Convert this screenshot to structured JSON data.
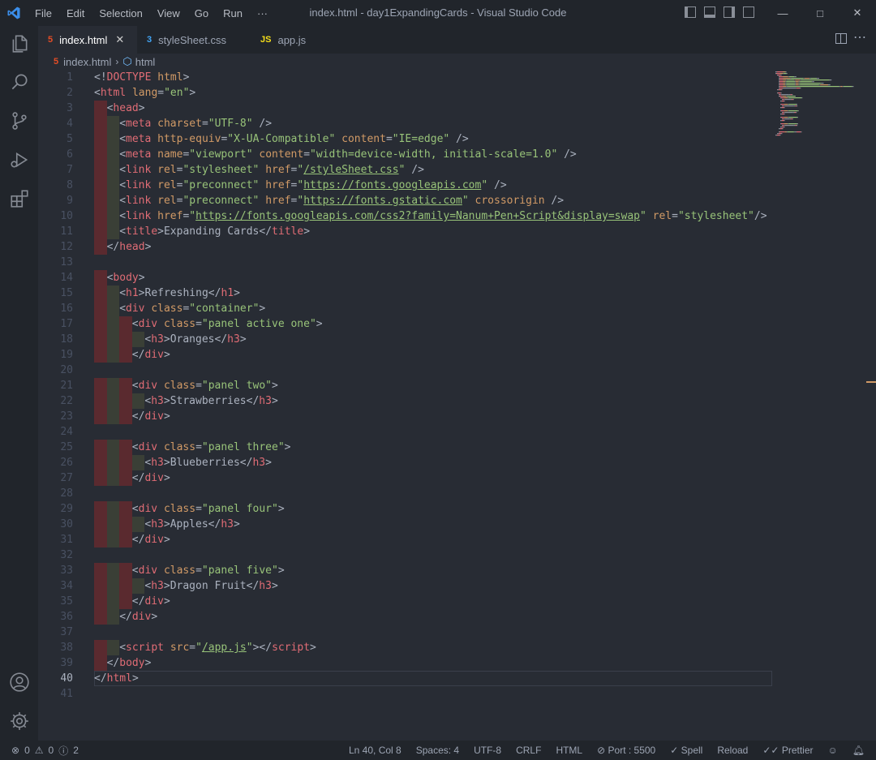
{
  "menu": [
    "File",
    "Edit",
    "Selection",
    "View",
    "Go",
    "Run",
    "···"
  ],
  "window_title": "index.html - day1ExpandingCards - Visual Studio Code",
  "tabs": [
    {
      "label": "index.html",
      "icon": "5",
      "icon_color": "#e44d26"
    },
    {
      "label": "styleSheet.css",
      "icon": "3",
      "icon_color": "#42a5f5"
    },
    {
      "label": "app.js",
      "icon": "JS",
      "icon_color": "#f5de19"
    }
  ],
  "breadcrumb": {
    "file": "index.html",
    "element": "html"
  },
  "editor": {
    "current_line": 40,
    "lines": [
      {
        "n": 1,
        "i": 0,
        "toks": [
          [
            "t-pun",
            "<!"
          ],
          [
            "t-tag",
            "DOCTYPE "
          ],
          [
            "t-attr",
            "html"
          ],
          [
            "t-pun",
            ">"
          ]
        ]
      },
      {
        "n": 2,
        "i": 0,
        "toks": [
          [
            "t-pun",
            "<"
          ],
          [
            "t-tag",
            "html "
          ],
          [
            "t-attr",
            "lang"
          ],
          [
            "t-pun",
            "="
          ],
          [
            "t-str",
            "\"en\""
          ],
          [
            "t-pun",
            ">"
          ]
        ]
      },
      {
        "n": 3,
        "i": 1,
        "toks": [
          [
            "t-pun",
            "<"
          ],
          [
            "t-tag",
            "head"
          ],
          [
            "t-pun",
            ">"
          ]
        ]
      },
      {
        "n": 4,
        "i": 2,
        "toks": [
          [
            "t-pun",
            "<"
          ],
          [
            "t-tag",
            "meta "
          ],
          [
            "t-attr",
            "charset"
          ],
          [
            "t-pun",
            "="
          ],
          [
            "t-str",
            "\"UTF-8\""
          ],
          [
            "t-pun",
            " />"
          ]
        ]
      },
      {
        "n": 5,
        "i": 2,
        "toks": [
          [
            "t-pun",
            "<"
          ],
          [
            "t-tag",
            "meta "
          ],
          [
            "t-attr",
            "http-equiv"
          ],
          [
            "t-pun",
            "="
          ],
          [
            "t-str",
            "\"X-UA-Compatible\""
          ],
          [
            "t-pun",
            " "
          ],
          [
            "t-attr",
            "content"
          ],
          [
            "t-pun",
            "="
          ],
          [
            "t-str",
            "\"IE=edge\""
          ],
          [
            "t-pun",
            " />"
          ]
        ]
      },
      {
        "n": 6,
        "i": 2,
        "toks": [
          [
            "t-pun",
            "<"
          ],
          [
            "t-tag",
            "meta "
          ],
          [
            "t-attr",
            "name"
          ],
          [
            "t-pun",
            "="
          ],
          [
            "t-str",
            "\"viewport\""
          ],
          [
            "t-pun",
            " "
          ],
          [
            "t-attr",
            "content"
          ],
          [
            "t-pun",
            "="
          ],
          [
            "t-str",
            "\"width=device-width, initial-scale=1.0\""
          ],
          [
            "t-pun",
            " />"
          ]
        ]
      },
      {
        "n": 7,
        "i": 2,
        "toks": [
          [
            "t-pun",
            "<"
          ],
          [
            "t-tag",
            "link "
          ],
          [
            "t-attr",
            "rel"
          ],
          [
            "t-pun",
            "="
          ],
          [
            "t-str",
            "\"stylesheet\""
          ],
          [
            "t-pun",
            " "
          ],
          [
            "t-attr",
            "href"
          ],
          [
            "t-pun",
            "="
          ],
          [
            "t-str",
            "\""
          ],
          [
            "t-link",
            "/styleSheet.css"
          ],
          [
            "t-str",
            "\""
          ],
          [
            "t-pun",
            " />"
          ]
        ]
      },
      {
        "n": 8,
        "i": 2,
        "toks": [
          [
            "t-pun",
            "<"
          ],
          [
            "t-tag",
            "link "
          ],
          [
            "t-attr",
            "rel"
          ],
          [
            "t-pun",
            "="
          ],
          [
            "t-str",
            "\"preconnect\""
          ],
          [
            "t-pun",
            " "
          ],
          [
            "t-attr",
            "href"
          ],
          [
            "t-pun",
            "="
          ],
          [
            "t-str",
            "\""
          ],
          [
            "t-link",
            "https://fonts.googleapis.com"
          ],
          [
            "t-str",
            "\""
          ],
          [
            "t-pun",
            " />"
          ]
        ]
      },
      {
        "n": 9,
        "i": 2,
        "toks": [
          [
            "t-pun",
            "<"
          ],
          [
            "t-tag",
            "link "
          ],
          [
            "t-attr",
            "rel"
          ],
          [
            "t-pun",
            "="
          ],
          [
            "t-str",
            "\"preconnect\""
          ],
          [
            "t-pun",
            " "
          ],
          [
            "t-attr",
            "href"
          ],
          [
            "t-pun",
            "="
          ],
          [
            "t-str",
            "\""
          ],
          [
            "t-link",
            "https://fonts.gstatic.com"
          ],
          [
            "t-str",
            "\""
          ],
          [
            "t-pun",
            " "
          ],
          [
            "t-attr",
            "crossorigin"
          ],
          [
            "t-pun",
            " />"
          ]
        ]
      },
      {
        "n": 10,
        "i": 2,
        "toks": [
          [
            "t-pun",
            "<"
          ],
          [
            "t-tag",
            "link "
          ],
          [
            "t-attr",
            "href"
          ],
          [
            "t-pun",
            "="
          ],
          [
            "t-str",
            "\""
          ],
          [
            "t-link",
            "https://fonts.googleapis.com/css2?family=Nanum+Pen+Script&display=swap"
          ],
          [
            "t-str",
            "\""
          ],
          [
            "t-pun",
            " "
          ],
          [
            "t-attr",
            "rel"
          ],
          [
            "t-pun",
            "="
          ],
          [
            "t-str",
            "\"stylesheet\""
          ],
          [
            "t-pun",
            "/>"
          ]
        ]
      },
      {
        "n": 11,
        "i": 2,
        "toks": [
          [
            "t-pun",
            "<"
          ],
          [
            "t-tag",
            "title"
          ],
          [
            "t-pun",
            ">"
          ],
          [
            "t-txt",
            "Expanding Cards"
          ],
          [
            "t-pun",
            "</"
          ],
          [
            "t-tag",
            "title"
          ],
          [
            "t-pun",
            ">"
          ]
        ]
      },
      {
        "n": 12,
        "i": 1,
        "toks": [
          [
            "t-pun",
            "</"
          ],
          [
            "t-tag",
            "head"
          ],
          [
            "t-pun",
            ">"
          ]
        ]
      },
      {
        "n": 13,
        "i": 0,
        "toks": []
      },
      {
        "n": 14,
        "i": 1,
        "toks": [
          [
            "t-pun",
            "<"
          ],
          [
            "t-tag",
            "body"
          ],
          [
            "t-pun",
            ">"
          ]
        ]
      },
      {
        "n": 15,
        "i": 2,
        "toks": [
          [
            "t-pun",
            "<"
          ],
          [
            "t-tag",
            "h1"
          ],
          [
            "t-pun",
            ">"
          ],
          [
            "t-txt",
            "Refreshing"
          ],
          [
            "t-pun",
            "</"
          ],
          [
            "t-tag",
            "h1"
          ],
          [
            "t-pun",
            ">"
          ]
        ]
      },
      {
        "n": 16,
        "i": 2,
        "toks": [
          [
            "t-pun",
            "<"
          ],
          [
            "t-tag",
            "div "
          ],
          [
            "t-attr",
            "class"
          ],
          [
            "t-pun",
            "="
          ],
          [
            "t-str",
            "\"container\""
          ],
          [
            "t-pun",
            ">"
          ]
        ]
      },
      {
        "n": 17,
        "i": 3,
        "toks": [
          [
            "t-pun",
            "<"
          ],
          [
            "t-tag",
            "div "
          ],
          [
            "t-attr",
            "class"
          ],
          [
            "t-pun",
            "="
          ],
          [
            "t-str",
            "\"panel active one\""
          ],
          [
            "t-pun",
            ">"
          ]
        ]
      },
      {
        "n": 18,
        "i": 4,
        "toks": [
          [
            "t-pun",
            "<"
          ],
          [
            "t-tag",
            "h3"
          ],
          [
            "t-pun",
            ">"
          ],
          [
            "t-txt",
            "Oranges"
          ],
          [
            "t-pun",
            "</"
          ],
          [
            "t-tag",
            "h3"
          ],
          [
            "t-pun",
            ">"
          ]
        ]
      },
      {
        "n": 19,
        "i": 3,
        "toks": [
          [
            "t-pun",
            "</"
          ],
          [
            "t-tag",
            "div"
          ],
          [
            "t-pun",
            ">"
          ]
        ]
      },
      {
        "n": 20,
        "i": 0,
        "toks": []
      },
      {
        "n": 21,
        "i": 3,
        "toks": [
          [
            "t-pun",
            "<"
          ],
          [
            "t-tag",
            "div "
          ],
          [
            "t-attr",
            "class"
          ],
          [
            "t-pun",
            "="
          ],
          [
            "t-str",
            "\"panel two\""
          ],
          [
            "t-pun",
            ">"
          ]
        ]
      },
      {
        "n": 22,
        "i": 4,
        "toks": [
          [
            "t-pun",
            "<"
          ],
          [
            "t-tag",
            "h3"
          ],
          [
            "t-pun",
            ">"
          ],
          [
            "t-txt",
            "Strawberries"
          ],
          [
            "t-pun",
            "</"
          ],
          [
            "t-tag",
            "h3"
          ],
          [
            "t-pun",
            ">"
          ]
        ]
      },
      {
        "n": 23,
        "i": 3,
        "toks": [
          [
            "t-pun",
            "</"
          ],
          [
            "t-tag",
            "div"
          ],
          [
            "t-pun",
            ">"
          ]
        ]
      },
      {
        "n": 24,
        "i": 0,
        "toks": []
      },
      {
        "n": 25,
        "i": 3,
        "toks": [
          [
            "t-pun",
            "<"
          ],
          [
            "t-tag",
            "div "
          ],
          [
            "t-attr",
            "class"
          ],
          [
            "t-pun",
            "="
          ],
          [
            "t-str",
            "\"panel three\""
          ],
          [
            "t-pun",
            ">"
          ]
        ]
      },
      {
        "n": 26,
        "i": 4,
        "toks": [
          [
            "t-pun",
            "<"
          ],
          [
            "t-tag",
            "h3"
          ],
          [
            "t-pun",
            ">"
          ],
          [
            "t-txt",
            "Blueberries"
          ],
          [
            "t-pun",
            "</"
          ],
          [
            "t-tag",
            "h3"
          ],
          [
            "t-pun",
            ">"
          ]
        ]
      },
      {
        "n": 27,
        "i": 3,
        "toks": [
          [
            "t-pun",
            "</"
          ],
          [
            "t-tag",
            "div"
          ],
          [
            "t-pun",
            ">"
          ]
        ]
      },
      {
        "n": 28,
        "i": 0,
        "toks": []
      },
      {
        "n": 29,
        "i": 3,
        "toks": [
          [
            "t-pun",
            "<"
          ],
          [
            "t-tag",
            "div "
          ],
          [
            "t-attr",
            "class"
          ],
          [
            "t-pun",
            "="
          ],
          [
            "t-str",
            "\"panel four\""
          ],
          [
            "t-pun",
            ">"
          ]
        ]
      },
      {
        "n": 30,
        "i": 4,
        "toks": [
          [
            "t-pun",
            "<"
          ],
          [
            "t-tag",
            "h3"
          ],
          [
            "t-pun",
            ">"
          ],
          [
            "t-txt",
            "Apples"
          ],
          [
            "t-pun",
            "</"
          ],
          [
            "t-tag",
            "h3"
          ],
          [
            "t-pun",
            ">"
          ]
        ]
      },
      {
        "n": 31,
        "i": 3,
        "toks": [
          [
            "t-pun",
            "</"
          ],
          [
            "t-tag",
            "div"
          ],
          [
            "t-pun",
            ">"
          ]
        ]
      },
      {
        "n": 32,
        "i": 0,
        "toks": []
      },
      {
        "n": 33,
        "i": 3,
        "toks": [
          [
            "t-pun",
            "<"
          ],
          [
            "t-tag",
            "div "
          ],
          [
            "t-attr",
            "class"
          ],
          [
            "t-pun",
            "="
          ],
          [
            "t-str",
            "\"panel five\""
          ],
          [
            "t-pun",
            ">"
          ]
        ]
      },
      {
        "n": 34,
        "i": 4,
        "toks": [
          [
            "t-pun",
            "<"
          ],
          [
            "t-tag",
            "h3"
          ],
          [
            "t-pun",
            ">"
          ],
          [
            "t-txt",
            "Dragon Fruit"
          ],
          [
            "t-pun",
            "</"
          ],
          [
            "t-tag",
            "h3"
          ],
          [
            "t-pun",
            ">"
          ]
        ]
      },
      {
        "n": 35,
        "i": 3,
        "toks": [
          [
            "t-pun",
            "</"
          ],
          [
            "t-tag",
            "div"
          ],
          [
            "t-pun",
            ">"
          ]
        ]
      },
      {
        "n": 36,
        "i": 2,
        "toks": [
          [
            "t-pun",
            "</"
          ],
          [
            "t-tag",
            "div"
          ],
          [
            "t-pun",
            ">"
          ]
        ]
      },
      {
        "n": 37,
        "i": 0,
        "toks": []
      },
      {
        "n": 38,
        "i": 2,
        "toks": [
          [
            "t-pun",
            "<"
          ],
          [
            "t-tag",
            "script "
          ],
          [
            "t-attr",
            "src"
          ],
          [
            "t-pun",
            "="
          ],
          [
            "t-str",
            "\""
          ],
          [
            "t-link",
            "/app.js"
          ],
          [
            "t-str",
            "\""
          ],
          [
            "t-pun",
            "></"
          ],
          [
            "t-tag",
            "script"
          ],
          [
            "t-pun",
            ">"
          ]
        ]
      },
      {
        "n": 39,
        "i": 1,
        "toks": [
          [
            "t-pun",
            "</"
          ],
          [
            "t-tag",
            "body"
          ],
          [
            "t-pun",
            ">"
          ]
        ]
      },
      {
        "n": 40,
        "i": 0,
        "toks": [
          [
            "t-pun",
            "</"
          ],
          [
            "t-tag",
            "html"
          ],
          [
            "t-pun",
            ">"
          ]
        ]
      },
      {
        "n": 41,
        "i": 0,
        "toks": []
      }
    ]
  },
  "status": {
    "errors": "0",
    "warnings": "0",
    "info": "2",
    "position": "Ln 40, Col 8",
    "spaces": "Spaces: 4",
    "encoding": "UTF-8",
    "eol": "CRLF",
    "language": "HTML",
    "port": "Port : 5500",
    "spell": "Spell",
    "reload": "Reload",
    "prettier": "Prettier"
  },
  "colors": {
    "accent": "#3b8eea",
    "indent_odd": "#5a2a2f",
    "indent_even": "#3a3f36",
    "tag": "#e06c75",
    "attr": "#d19a66",
    "string": "#98c379"
  }
}
